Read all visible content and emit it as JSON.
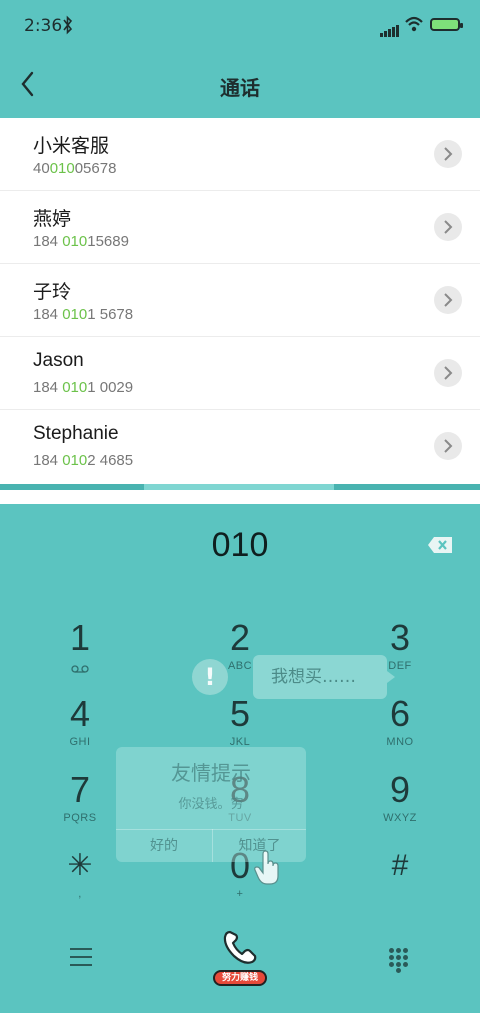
{
  "status_bar": {
    "time": "2:36"
  },
  "header": {
    "title": "通话"
  },
  "contacts": [
    {
      "name": "小米客服",
      "num_pre": "40",
      "num_hl": "010",
      "num_post": "05678"
    },
    {
      "name": "燕婷",
      "num_pre": "184 ",
      "num_hl": "010",
      "num_post": "15689"
    },
    {
      "name": "子玲",
      "num_pre": "184 ",
      "num_hl": "010",
      "num_post": "1 5678"
    },
    {
      "name": "Jason",
      "num_pre": "184 ",
      "num_hl": "010",
      "num_post": "1 0029"
    },
    {
      "name": "Stephanie",
      "num_pre": "184 ",
      "num_hl": "010",
      "num_post": "2 4685"
    }
  ],
  "dialer": {
    "number": "010",
    "keys": [
      {
        "digit": "1",
        "letters": ""
      },
      {
        "digit": "2",
        "letters": "ABC"
      },
      {
        "digit": "3",
        "letters": "DEF"
      },
      {
        "digit": "4",
        "letters": "GHI"
      },
      {
        "digit": "5",
        "letters": "JKL"
      },
      {
        "digit": "6",
        "letters": "MNO"
      },
      {
        "digit": "7",
        "letters": "PQRS"
      },
      {
        "digit": "8",
        "letters": "TUV"
      },
      {
        "digit": "9",
        "letters": "WXYZ"
      },
      {
        "digit": "✳",
        "letters": ","
      },
      {
        "digit": "0",
        "letters": "+"
      },
      {
        "digit": "#",
        "letters": ""
      }
    ]
  },
  "overlay": {
    "bubble_text": "我想买……",
    "warning_symbol": "!",
    "dialog_title": "友情提示",
    "dialog_message": "你没钱。穷",
    "dialog_ok": "好的",
    "dialog_know": "知道了"
  },
  "bottom_bar": {
    "call_badge": "努力赚钱"
  },
  "colors": {
    "background": "#5bc4c0",
    "highlight": "#6cc24a",
    "badge": "#e64a3a"
  },
  "icons": [
    "back-icon",
    "chevron-right-icon",
    "backspace-icon",
    "voicemail-icon",
    "menu-icon",
    "phone-icon",
    "keypad-icon",
    "warning-icon",
    "hand-pointer-icon"
  ]
}
